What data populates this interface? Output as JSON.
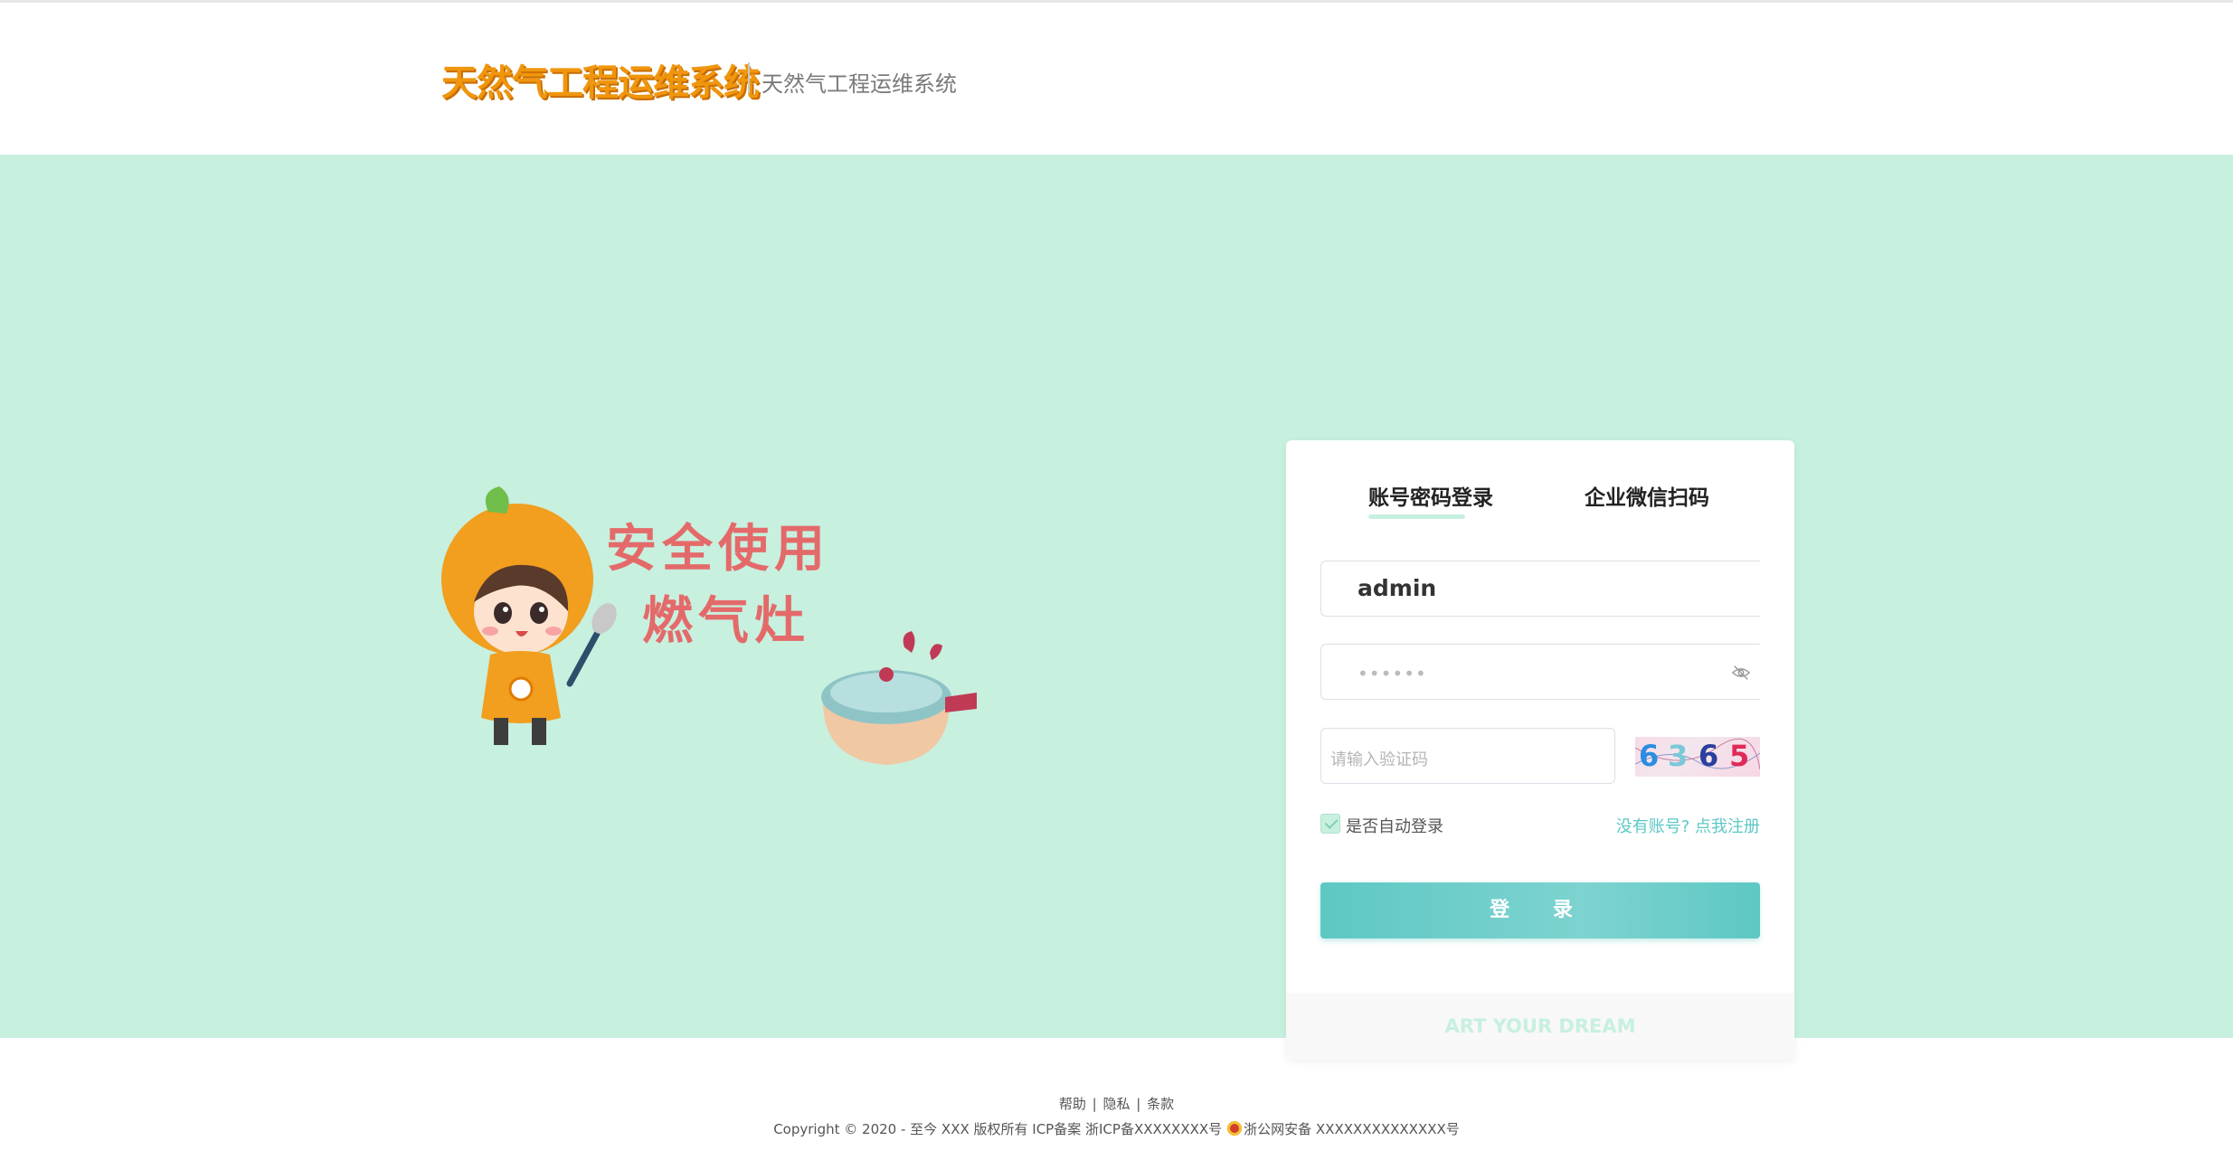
{
  "header": {
    "logo_text": "天然气工程运维系统",
    "subtitle": "天然气工程运维系统"
  },
  "illustration": {
    "line1": "安全使用",
    "line2": "燃气灶"
  },
  "login": {
    "tabs": [
      {
        "label": "账号密码登录",
        "active": true
      },
      {
        "label": "企业微信扫码",
        "active": false
      }
    ],
    "username_value": "admin",
    "password_masked": "••••••",
    "captcha_placeholder": "请输入验证码",
    "captcha_digits": [
      "6",
      "3",
      "6",
      "5"
    ],
    "remember_label": "是否自动登录",
    "remember_checked": true,
    "register_link": "没有账号? 点我注册",
    "login_button": "登 录",
    "footer_slogan": "ART YOUR DREAM"
  },
  "footer": {
    "links": [
      "帮助",
      "隐私",
      "条款"
    ],
    "separator": "|",
    "copyright": "Copyright © 2020 - 至今 XXX 版权所有 ICP备案 浙ICP备XXXXXXXX号",
    "police": "浙公网安备 XXXXXXXXXXXXXX号"
  },
  "colors": {
    "accent": "#5ec8c3",
    "background": "#c7f0df",
    "logo": "#f0960d",
    "illustration_text": "#e46a6a"
  },
  "icons": [
    "eye-off-icon",
    "check-icon",
    "police-badge-icon"
  ]
}
